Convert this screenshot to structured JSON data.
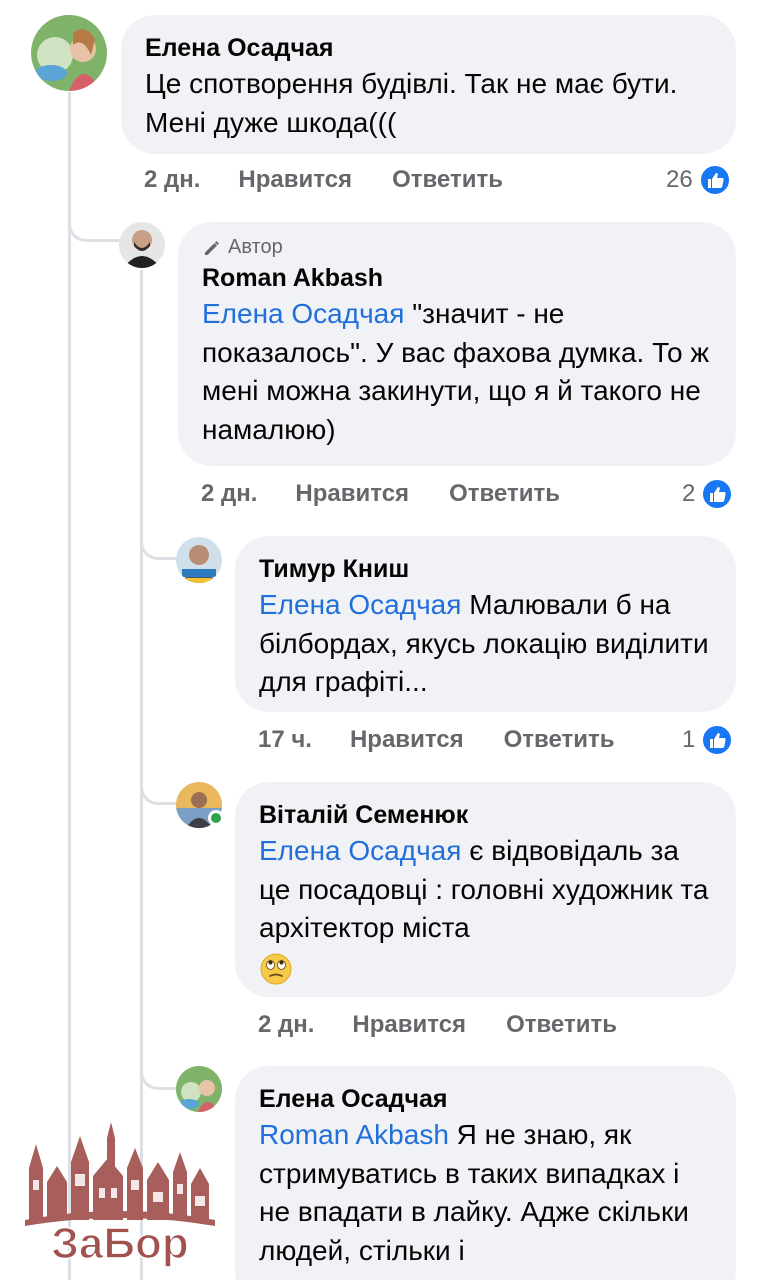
{
  "comments": [
    {
      "name": "Елена Осадчая",
      "text": "Це спотворення будівлі. Так не має бути. Мені дуже шкода(((",
      "time": "2 дн.",
      "like_label": "Нравится",
      "reply_label": "Ответить",
      "reaction_count": "26"
    },
    {
      "badge": "Автор",
      "name": "Roman Akbash",
      "mention": "Елена Осадчая",
      "text": " \"значит - не показалось\". У вас фахова думка. То ж мені можна закинути, що я й такого не намалюю)",
      "time": "2 дн.",
      "like_label": "Нравится",
      "reply_label": "Ответить",
      "reaction_count": "2"
    },
    {
      "name": "Тимур Книш",
      "mention": "Елена Осадчая",
      "text": " Малювали б на білбордах, якусь локацію виділити для графіті...",
      "time": "17 ч.",
      "like_label": "Нравится",
      "reply_label": "Ответить",
      "reaction_count": "1"
    },
    {
      "name": "Віталій Семенюк",
      "mention": "Елена Осадчая",
      "text": " є відвовідаль за це посадовці : головні художник та архітектор міста",
      "emoji": "face-with-rolling-eyes",
      "time": "2 дн.",
      "like_label": "Нравится",
      "reply_label": "Ответить"
    },
    {
      "name": "Елена Осадчая",
      "mention": "Roman Akbash",
      "text": " Я не знаю, як стримуватись в таких випадках і не впадати в лайку. Адже скільки людей, стільки і"
    }
  ],
  "watermark": {
    "text": "ЗаБор",
    "color": "#a1524f"
  },
  "colors": {
    "mention": "#216fdb",
    "bubble": "#f0f2f5",
    "meta": "#65676b",
    "like": "#1877f2"
  },
  "icons": [
    "pencil-icon",
    "like-icon",
    "online-status-icon"
  ]
}
